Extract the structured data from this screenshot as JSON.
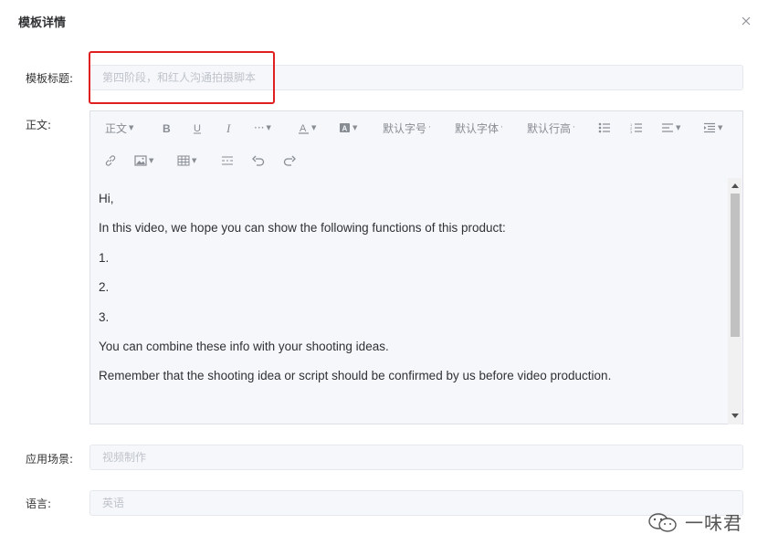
{
  "dialog": {
    "title": "模板详情"
  },
  "form": {
    "title_label": "模板标题:",
    "title_placeholder": "第四阶段，和红人沟通拍摄脚本",
    "body_label": "正文:",
    "scene_label": "应用场景:",
    "scene_placeholder": "视频制作",
    "language_label": "语言:",
    "language_placeholder": "英语"
  },
  "toolbar": {
    "paragraph": "正文",
    "font_size": "默认字号",
    "font_family": "默认字体",
    "line_height": "默认行高",
    "more": "···"
  },
  "editor": {
    "paragraphs": [
      "Hi,",
      "In this video, we hope you can show the following functions of this product:",
      "1.",
      "2.",
      "3.",
      "You can combine these info with your shooting ideas.",
      "Remember that the shooting idea or script should be confirmed by us before video production."
    ]
  },
  "watermark": {
    "text": "一味君"
  },
  "colors": {
    "highlight": "#e02020",
    "field_bg": "#f5f7fa",
    "placeholder": "#bfc3cb"
  }
}
